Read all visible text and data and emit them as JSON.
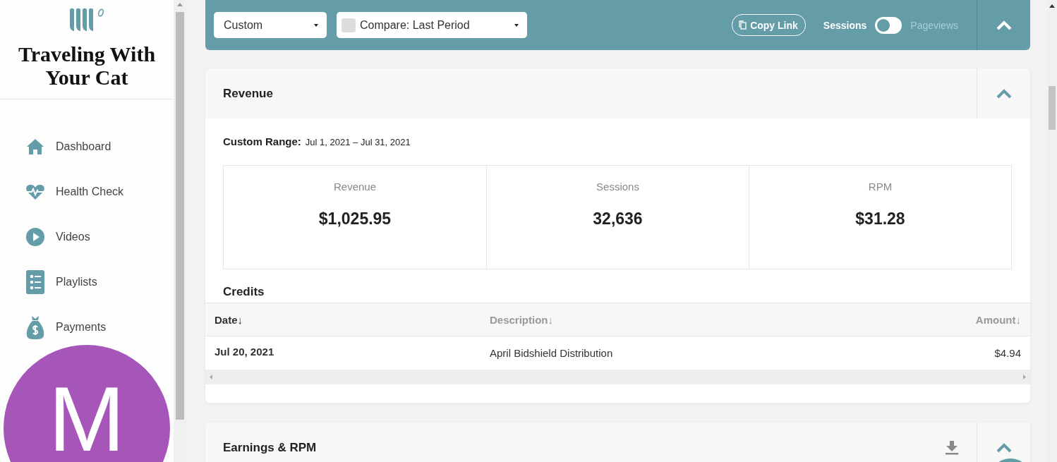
{
  "sidebar": {
    "site_title": "Traveling With Your Cat",
    "items": [
      {
        "label": "Dashboard"
      },
      {
        "label": "Health Check"
      },
      {
        "label": "Videos"
      },
      {
        "label": "Playlists"
      },
      {
        "label": "Payments"
      }
    ],
    "avatar": {
      "initial": "M",
      "color": "#a656b9"
    }
  },
  "toolbar": {
    "range_select": "Custom",
    "compare": {
      "label": "Compare: Last Period",
      "checked": false
    },
    "copy_link": "Copy Link",
    "toggle": {
      "left": "Sessions",
      "right": "Pageviews",
      "on": false
    }
  },
  "revenue": {
    "title": "Revenue",
    "range_label": "Custom Range:",
    "range_value": "Jul 1, 2021 – Jul 31, 2021",
    "stats": [
      {
        "label": "Revenue",
        "value": "$1,025.95"
      },
      {
        "label": "Sessions",
        "value": "32,636"
      },
      {
        "label": "RPM",
        "value": "$31.28"
      }
    ],
    "credits": {
      "title": "Credits",
      "columns": [
        {
          "label": "Date↓",
          "sorted": true
        },
        {
          "label": "Description↓",
          "sorted": false
        },
        {
          "label": "Amount↓",
          "sorted": false
        }
      ],
      "rows": [
        [
          "Jul 20, 2021",
          "April Bidshield Distribution",
          "$4.94"
        ]
      ]
    }
  },
  "earnings": {
    "title": "Earnings & RPM"
  }
}
